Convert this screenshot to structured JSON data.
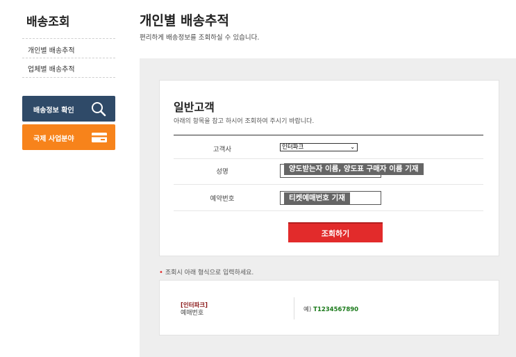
{
  "sidebar": {
    "title": "배송조회",
    "items": [
      {
        "label": "개인별 배송추적"
      },
      {
        "label": "업체별 배송추적"
      }
    ],
    "buttons": [
      {
        "label": "배송정보 확인",
        "icon": "search-icon",
        "color": "#2f4a68"
      },
      {
        "label": "국제 사업분야",
        "icon": "card-icon",
        "color": "#f7831b"
      }
    ]
  },
  "header": {
    "title": "개인별 배송추적",
    "subtitle": "편리하게 배송정보를 조회하실 수 있습니다."
  },
  "form": {
    "title": "일반고객",
    "description": "아래의 항목을 참고 하시어 조회하여 주시기 바랍니다.",
    "rows": [
      {
        "label": "고객사",
        "value": "인터파크"
      },
      {
        "label": "성명",
        "tooltip": "양도받는자 이름, 양도표 구매자 이름 기재"
      },
      {
        "label": "예약번호",
        "tooltip": "티켓예매번호 기재"
      }
    ],
    "submit_label": "조회하기"
  },
  "example": {
    "note": "조회시 아래 형식으로 입력하세요.",
    "brand": "[인터파크]",
    "field": "예매번호",
    "prefix": "예)",
    "code": "T1234567890"
  },
  "colors": {
    "accent_red": "#e22b2b",
    "navy": "#2f4a68",
    "orange": "#f7831b"
  }
}
